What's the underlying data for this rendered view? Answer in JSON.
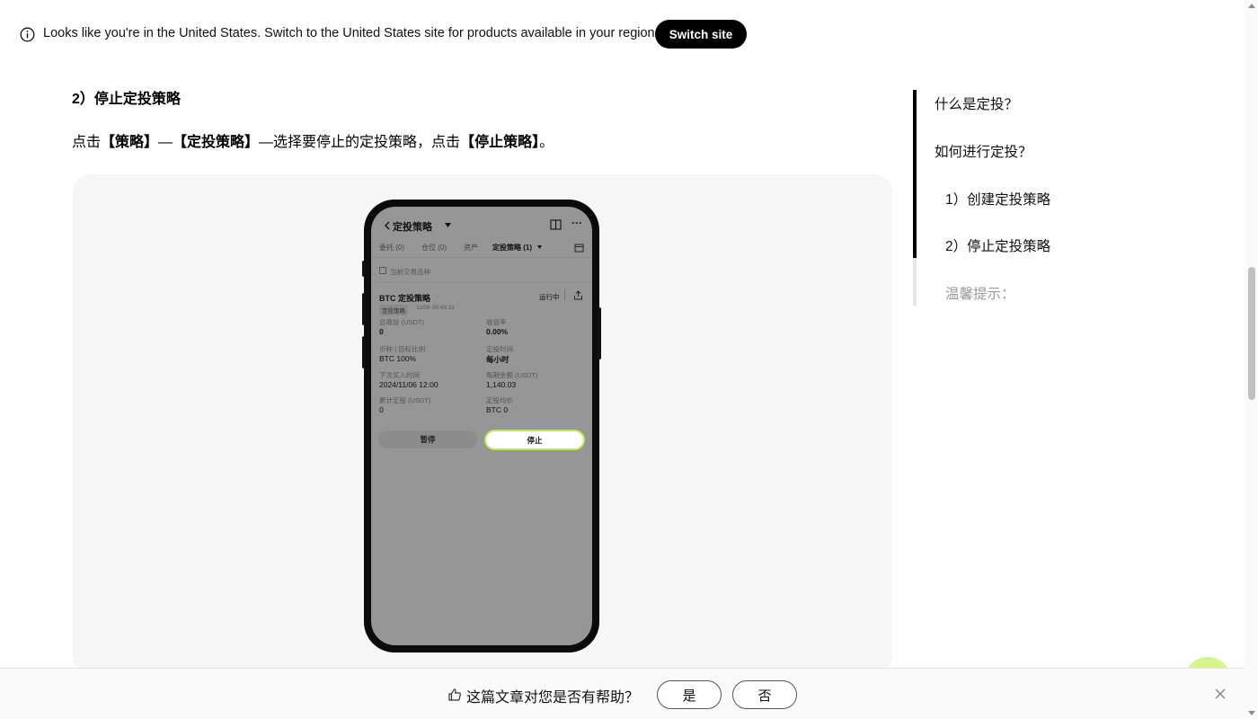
{
  "banner": {
    "message": "Looks like you're in the United States. Switch to the United States site for products available in your region.",
    "switch_label": "Switch site",
    "icon": "info-icon"
  },
  "article": {
    "heading": "2）停止定投策略",
    "para": {
      "p1": "点击",
      "b1": "【策略】",
      "p2": "—",
      "b2": "【定投策略】",
      "p3": "—选择要停止的定投策略，点击",
      "b3": "【停止策略】",
      "p4": "。"
    }
  },
  "phone": {
    "title": "定投策略",
    "tabs": [
      "委托 (0)",
      "仓位 (0)",
      "资产",
      "定投策略 (1)"
    ],
    "filter": "当前交易品种",
    "strategy_name": "BTC 定投策略",
    "status": "运行中",
    "badge": "定投策略",
    "created": "11/06 09:43:31",
    "fields": [
      {
        "label": "总收益 (USDT)",
        "value": "0"
      },
      {
        "label": "收益率",
        "value": "0.00%"
      },
      {
        "label": "币种 | 目标比例",
        "value": "BTC 100%"
      },
      {
        "label": "定投时间",
        "value": "每小时"
      },
      {
        "label": "下次买入时间",
        "value": "2024/11/06 12:00"
      },
      {
        "label": "每期金额 (USDT)",
        "value": "1,140.03"
      },
      {
        "label": "累计定投 (USDT)",
        "value": "0"
      },
      {
        "label": "定投均价",
        "value": "BTC 0"
      }
    ],
    "pause_label": "暂停",
    "stop_label": "停止"
  },
  "toc": {
    "items": [
      "什么是定投？",
      "如何进行定投？",
      "1）创建定投策略",
      "2）停止定投策略",
      "温馨提示："
    ]
  },
  "feedback": {
    "question": "这篇文章对您是否有帮助？",
    "yes": "是",
    "no": "否"
  },
  "colors": {
    "accent_green": "#b9ec4a",
    "fab_green": "#d5f58a",
    "button_black": "#000000"
  }
}
